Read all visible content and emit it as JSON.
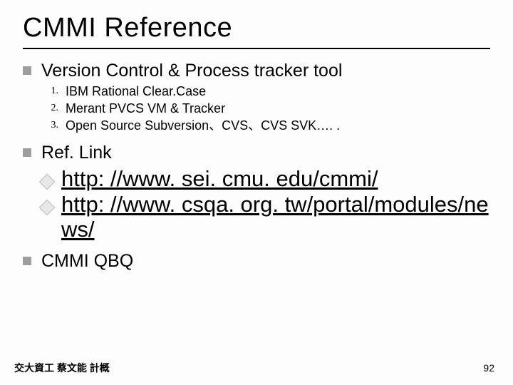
{
  "title": "CMMI Reference",
  "sections": {
    "s1": {
      "heading": "Version Control & Process tracker  tool"
    },
    "list": {
      "i1": {
        "n": "1.",
        "t": "IBM Rational Clear.Case"
      },
      "i2": {
        "n": "2.",
        "t": "Merant  PVCS VM & Tracker"
      },
      "i3": {
        "n": "3.",
        "t": "Open Source Subversion、CVS、CVS SVK…. ."
      }
    },
    "s2": {
      "heading": "Ref. Link"
    },
    "links": {
      "l1": "http: //www. sei. cmu. edu/cmmi/",
      "l2": "http: //www. csqa. org. tw/portal/modules/news/"
    },
    "s3": {
      "heading": "CMMI QBQ"
    }
  },
  "footer": {
    "left": "交大資工 蔡文能 計概",
    "page": "92"
  }
}
